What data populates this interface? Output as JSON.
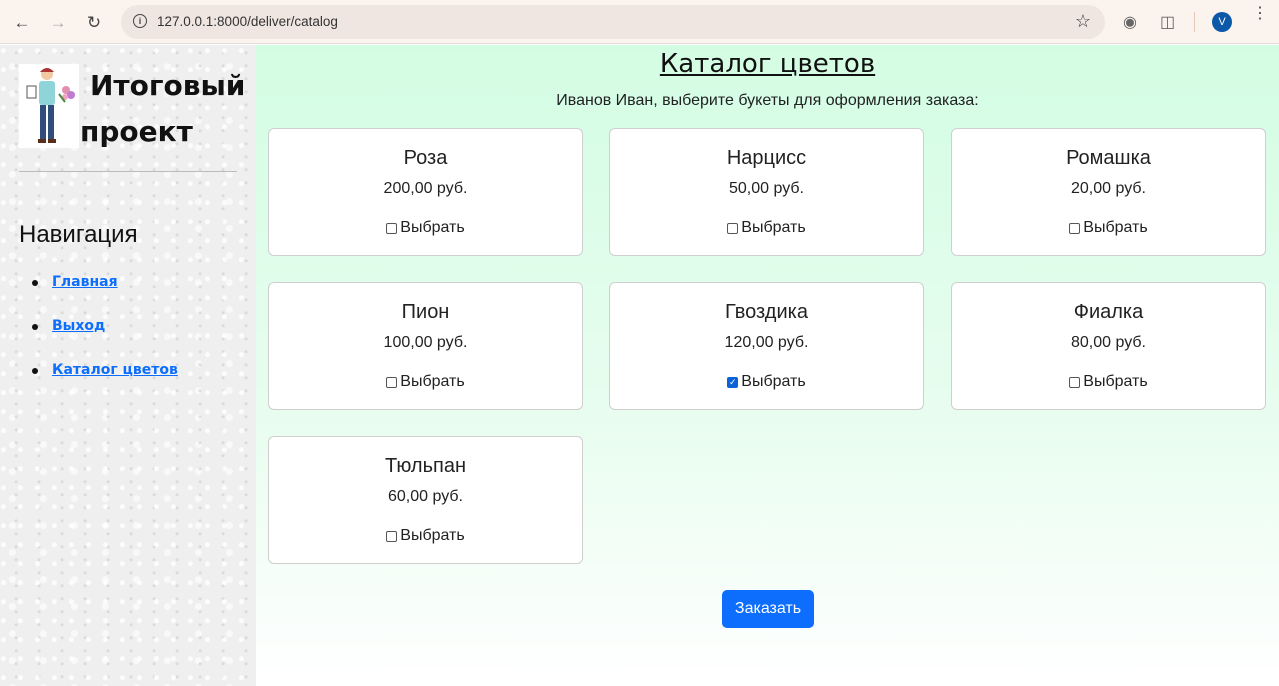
{
  "browser": {
    "url": "127.0.0.1:8000/deliver/catalog",
    "avatar_letter": "V"
  },
  "sidebar": {
    "brand_line1": "Итоговый",
    "brand_line2": "проект",
    "nav_title": "Навигация",
    "nav_items": [
      {
        "label": "Главная"
      },
      {
        "label": "Выход"
      },
      {
        "label": "Каталог цветов"
      }
    ]
  },
  "main": {
    "title": "Каталог цветов",
    "subtitle": "Иванов Иван, выберите букеты для оформления заказа:",
    "select_label": "Выбрать",
    "cards": [
      {
        "name": "Роза",
        "price": "200,00 руб.",
        "checked": false
      },
      {
        "name": "Нарцисс",
        "price": "50,00 руб.",
        "checked": false
      },
      {
        "name": "Ромашка",
        "price": "20,00 руб.",
        "checked": false
      },
      {
        "name": "Пион",
        "price": "100,00 руб.",
        "checked": false
      },
      {
        "name": "Гвоздика",
        "price": "120,00 руб.",
        "checked": true
      },
      {
        "name": "Фиалка",
        "price": "80,00 руб.",
        "checked": false
      },
      {
        "name": "Тюльпан",
        "price": "60,00 руб.",
        "checked": false
      }
    ],
    "order_button": "Заказать"
  },
  "colors": {
    "accent": "#0d6efd",
    "main_bg_top": "#d3fde3"
  }
}
